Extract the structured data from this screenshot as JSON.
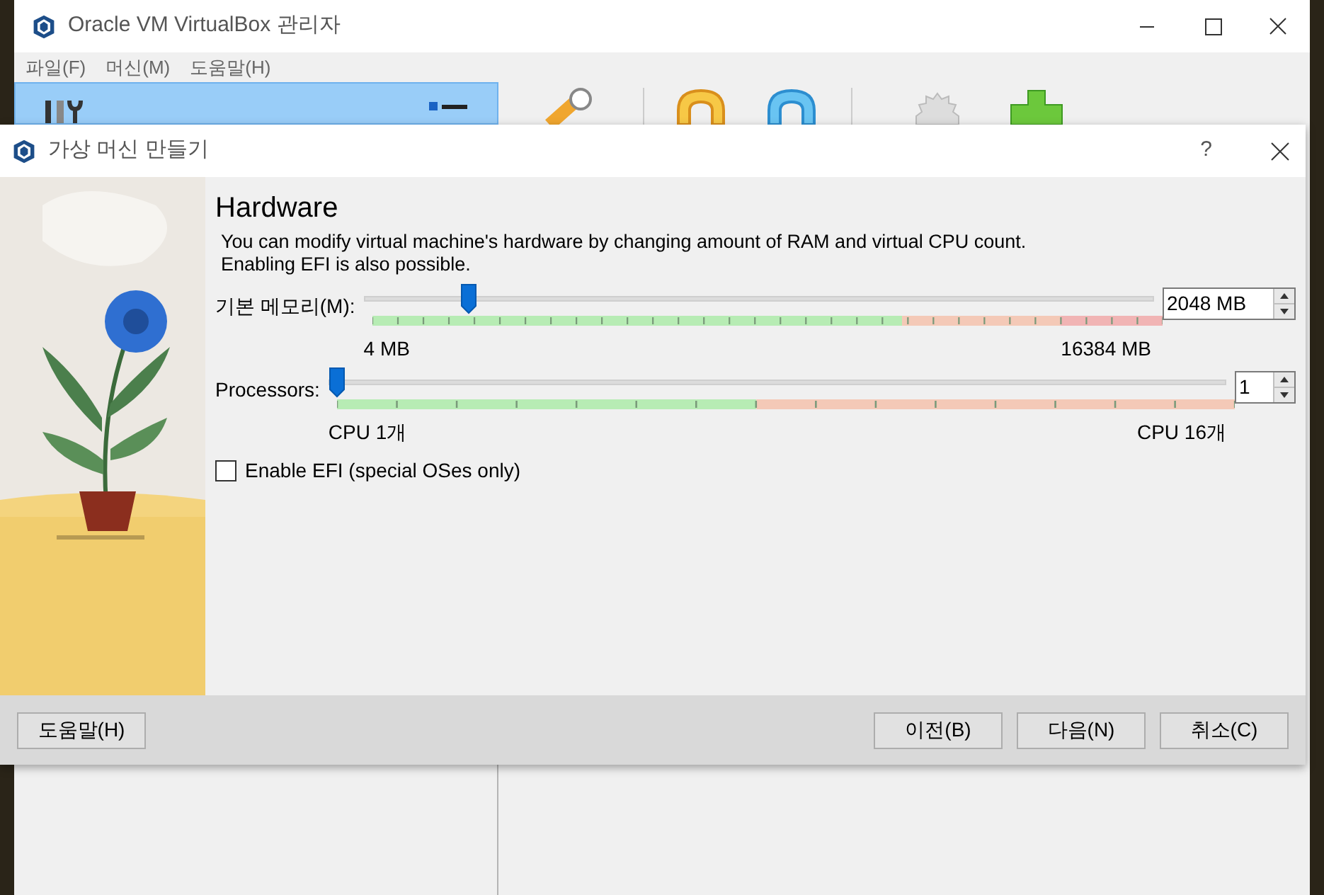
{
  "manager_window": {
    "title": "Oracle VM VirtualBox 관리자",
    "menu": [
      "파일(F)",
      "머신(M)",
      "도움말(H)"
    ]
  },
  "dialog": {
    "title": "가상 머신 만들기",
    "help_mark": "?",
    "heading": "Hardware",
    "description": "You can modify virtual machine's hardware by changing amount of RAM and virtual CPU count.\nEnabling EFI is also possible.",
    "memory": {
      "label": "기본 메모리(M):",
      "level": 0.125,
      "min_label": "4 MB",
      "max_label": "16384 MB",
      "value": "2048 MB"
    },
    "processors": {
      "label": "Processors:",
      "level": 0,
      "min_label": "CPU 1개",
      "max_label": "CPU 16개",
      "value": "1"
    },
    "efi": {
      "label": "Enable EFI (special OSes only)",
      "checked": false
    },
    "buttons": [
      {
        "label": "도움말(H)",
        "kind": "help"
      },
      {
        "label": "이전(B)",
        "kind": "nav"
      },
      {
        "label": "다음(N)",
        "kind": "nav"
      },
      {
        "label": "취소(C)",
        "kind": "nav"
      }
    ]
  }
}
